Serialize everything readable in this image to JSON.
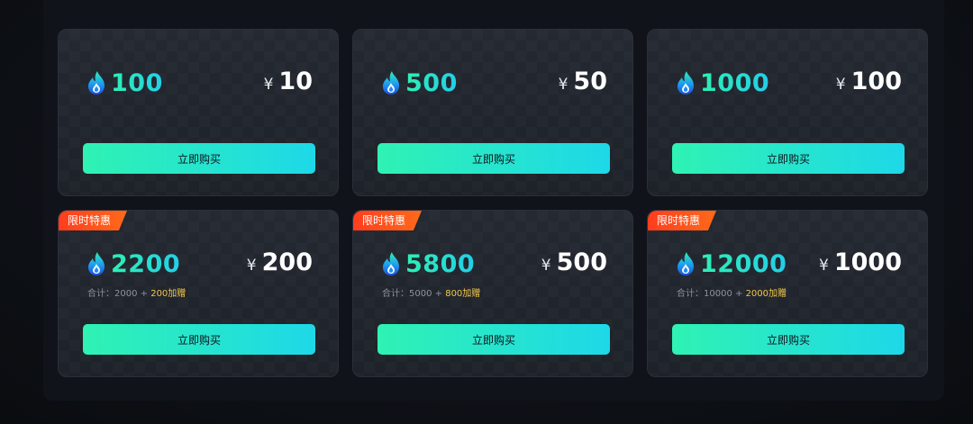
{
  "top_hint": {
    "text": "...",
    "link": ""
  },
  "cards": [
    {
      "amount": "100",
      "currency": "¥",
      "price": "10",
      "button": "立即购买"
    },
    {
      "amount": "500",
      "currency": "¥",
      "price": "50",
      "button": "立即购买"
    },
    {
      "amount": "1000",
      "currency": "¥",
      "price": "100",
      "button": "立即购买"
    },
    {
      "badge": "限时特惠",
      "amount": "2200",
      "currency": "¥",
      "price": "200",
      "total_label": "合计：",
      "base": "2000",
      "plus": " + ",
      "bonus": "200加赠",
      "button": "立即购买"
    },
    {
      "badge": "限时特惠",
      "amount": "5800",
      "currency": "¥",
      "price": "500",
      "total_label": "合计：",
      "base": "5000",
      "plus": " + ",
      "bonus": "800加赠",
      "button": "立即购买"
    },
    {
      "badge": "限时特惠",
      "amount": "12000",
      "currency": "¥",
      "price": "1000",
      "total_label": "合计：",
      "base": "10000",
      "plus": " + ",
      "bonus": "2000加赠",
      "button": "立即购买"
    }
  ],
  "colors": {
    "accent_start": "#2df0b4",
    "accent_end": "#22cfe8",
    "badge": "#ff4a1c",
    "bonus": "#f2c84b"
  },
  "icons": {
    "coin": "flame-coin-icon"
  }
}
